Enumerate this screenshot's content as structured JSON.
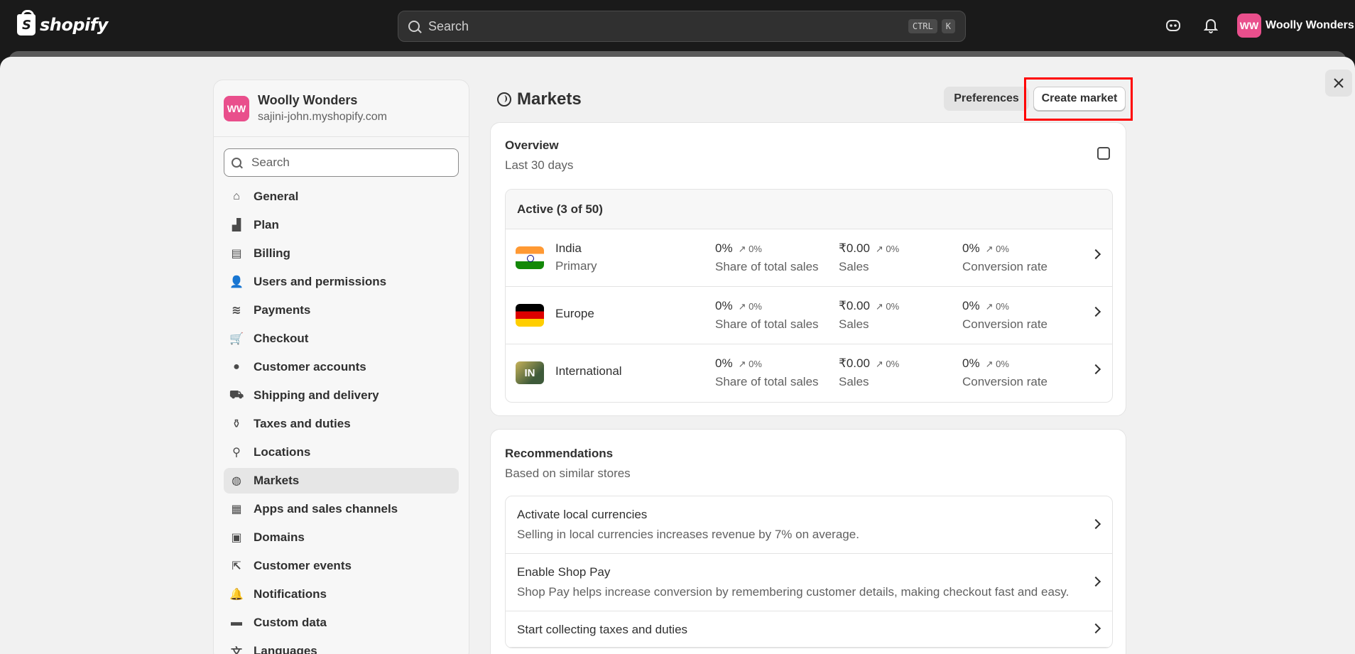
{
  "topbar": {
    "logo_text": "shopify",
    "search_placeholder": "Search",
    "kbd1": "CTRL",
    "kbd2": "K",
    "store_initials": "WW",
    "store_name": "Woolly Wonders",
    "icons": [
      "bag-icon",
      "bell-icon"
    ]
  },
  "sidebar": {
    "store_initials": "WW",
    "store_name": "Woolly Wonders",
    "store_domain": "sajini-john.myshopify.com",
    "search_placeholder": "Search",
    "items": [
      {
        "label": "General",
        "icon": "store-icon"
      },
      {
        "label": "Plan",
        "icon": "plan-icon"
      },
      {
        "label": "Billing",
        "icon": "billing-icon"
      },
      {
        "label": "Users and permissions",
        "icon": "users-icon"
      },
      {
        "label": "Payments",
        "icon": "payments-icon"
      },
      {
        "label": "Checkout",
        "icon": "cart-icon"
      },
      {
        "label": "Customer accounts",
        "icon": "person-icon"
      },
      {
        "label": "Shipping and delivery",
        "icon": "truck-icon"
      },
      {
        "label": "Taxes and duties",
        "icon": "tax-icon"
      },
      {
        "label": "Locations",
        "icon": "location-icon"
      },
      {
        "label": "Markets",
        "icon": "globe-icon"
      },
      {
        "label": "Apps and sales channels",
        "icon": "apps-icon"
      },
      {
        "label": "Domains",
        "icon": "domains-icon"
      },
      {
        "label": "Customer events",
        "icon": "cursor-icon"
      },
      {
        "label": "Notifications",
        "icon": "bell-icon"
      },
      {
        "label": "Custom data",
        "icon": "data-icon"
      },
      {
        "label": "Languages",
        "icon": "language-icon"
      }
    ]
  },
  "main": {
    "title": "Markets",
    "preferences_label": "Preferences",
    "create_label": "Create market",
    "overview": {
      "title": "Overview",
      "subtitle": "Last 30 days",
      "active_header": "Active (3 of 50)",
      "markets": [
        {
          "name": "India",
          "sub": "Primary",
          "flag": "india",
          "share": "0%",
          "share_delta": "↗ 0%",
          "share_label": "Share of total sales",
          "sales": "₹0.00",
          "sales_delta": "↗ 0%",
          "sales_label": "Sales",
          "conv": "0%",
          "conv_delta": "↗ 0%",
          "conv_label": "Conversion rate"
        },
        {
          "name": "Europe",
          "sub": "",
          "flag": "germany",
          "share": "0%",
          "share_delta": "↗ 0%",
          "share_label": "Share of total sales",
          "sales": "₹0.00",
          "sales_delta": "↗ 0%",
          "sales_label": "Sales",
          "conv": "0%",
          "conv_delta": "↗ 0%",
          "conv_label": "Conversion rate"
        },
        {
          "name": "International",
          "sub": "",
          "flag": "IN",
          "share": "0%",
          "share_delta": "↗ 0%",
          "share_label": "Share of total sales",
          "sales": "₹0.00",
          "sales_delta": "↗ 0%",
          "sales_label": "Sales",
          "conv": "0%",
          "conv_delta": "↗ 0%",
          "conv_label": "Conversion rate"
        }
      ]
    },
    "recommendations": {
      "title": "Recommendations",
      "subtitle": "Based on similar stores",
      "items": [
        {
          "title": "Activate local currencies",
          "desc": "Selling in local currencies increases revenue by 7% on average."
        },
        {
          "title": "Enable Shop Pay",
          "desc": "Shop Pay helps increase conversion by remembering customer details, making checkout fast and easy."
        },
        {
          "title": "Start collecting taxes and duties",
          "desc": ""
        }
      ]
    }
  },
  "colors": {
    "accent_avatar": "#e94f8c",
    "highlight": "#ff0000"
  }
}
